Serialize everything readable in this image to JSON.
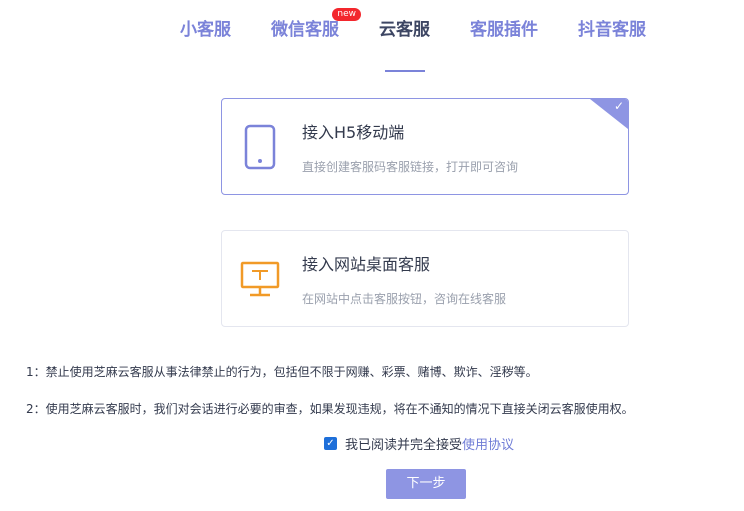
{
  "tabs": [
    {
      "label": "小客服"
    },
    {
      "label": "微信客服",
      "badge": "new"
    },
    {
      "label": "云客服"
    },
    {
      "label": "客服插件"
    },
    {
      "label": "抖音客服"
    }
  ],
  "options": [
    {
      "title": "接入H5移动端",
      "desc": "直接创建客服码客服链接，打开即可咨询",
      "icon": "mobile-phone-icon",
      "icon_color": "#7b83d9",
      "selected": true
    },
    {
      "title": "接入网站桌面客服",
      "desc": "在网站中点击客服按钮，咨询在线客服",
      "icon": "desktop-monitor-icon",
      "icon_color": "#f19a27",
      "selected": false
    }
  ],
  "notices": [
    "1：禁止使用芝麻云客服从事法律禁止的行为，包括但不限于网赚、彩票、赌博、欺诈、淫秽等。",
    "2：使用芝麻云客服时，我们对会话进行必要的审查，如果发现违规，将在不通知的情况下直接关闭云客服使用权。"
  ],
  "agreement": {
    "text": "我已阅读并完全接受",
    "link": "使用协议",
    "checked": true
  },
  "next_button": "下一步",
  "colors": {
    "accent": "#8e95e3",
    "tab_text": "#7b83d9",
    "badge": "#f3272d",
    "desktop_icon": "#f19a27"
  }
}
